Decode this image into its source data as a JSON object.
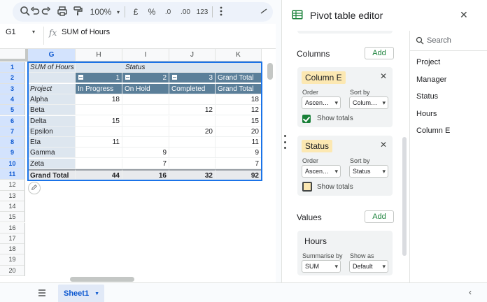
{
  "toolbar": {
    "zoom": "100%",
    "currency": "£",
    "percent": "%",
    "dec_decrease": ".0",
    "dec_increase": ".00",
    "number_format": "123"
  },
  "formula_bar": {
    "cell_ref": "G1",
    "fx": "fx",
    "formula": "SUM of Hours"
  },
  "grid": {
    "columns": [
      "G",
      "H",
      "I",
      "J",
      "K"
    ],
    "rows": [
      "1",
      "2",
      "3",
      "4",
      "5",
      "6",
      "7",
      "8",
      "9",
      "10",
      "11",
      "12",
      "13",
      "14",
      "15",
      "16",
      "17",
      "18",
      "19",
      "20"
    ],
    "pivot": {
      "value_header": "SUM of Hours",
      "col_field": "Status",
      "col_index": [
        "1",
        "2",
        "3"
      ],
      "grand_total": "Grand Total",
      "row_field": "Project",
      "col_labels": [
        "In Progress",
        "On Hold",
        "Completed",
        "Grand Total"
      ],
      "data_rows": [
        {
          "label": "Alpha",
          "vals": [
            "18",
            "",
            "",
            "18"
          ]
        },
        {
          "label": "Beta",
          "vals": [
            "",
            "",
            "12",
            "12"
          ]
        },
        {
          "label": "Delta",
          "vals": [
            "15",
            "",
            "",
            "15"
          ]
        },
        {
          "label": "Epsilon",
          "vals": [
            "",
            "",
            "20",
            "20"
          ]
        },
        {
          "label": "Eta",
          "vals": [
            "11",
            "",
            "",
            "11"
          ]
        },
        {
          "label": "Gamma",
          "vals": [
            "",
            "9",
            "",
            "9"
          ]
        },
        {
          "label": "Zeta",
          "vals": [
            "",
            "7",
            "",
            "7"
          ]
        }
      ],
      "total_row": {
        "label": "Grand Total",
        "vals": [
          "44",
          "16",
          "32",
          "92"
        ]
      }
    }
  },
  "sheet_tabs": {
    "active": "Sheet1"
  },
  "editor": {
    "title": "Pivot table editor",
    "columns_label": "Columns",
    "values_label": "Values",
    "add_label": "Add",
    "cards": [
      {
        "field": "Column E",
        "order_label": "Order",
        "order_value": "Ascen…",
        "sort_label": "Sort by",
        "sort_value": "Colum…",
        "totals_label": "Show totals",
        "totals_checked": true
      },
      {
        "field": "Status",
        "order_label": "Order",
        "order_value": "Ascen…",
        "sort_label": "Sort by",
        "sort_value": "Status",
        "totals_label": "Show totals",
        "totals_checked": false
      }
    ],
    "value_card": {
      "field": "Hours",
      "summarise_label": "Summarise by",
      "summarise_value": "SUM",
      "show_as_label": "Show as",
      "show_as_value": "Default"
    },
    "search_placeholder": "Search",
    "fields": [
      "Project",
      "Manager",
      "Status",
      "Hours",
      "Column E"
    ]
  },
  "colors": {
    "pivot_header": "#5b7f99",
    "pivot_light": "#dde6ef",
    "accent_green": "#188038",
    "chip_yellow": "#fce8b2",
    "selection": "#1a73e8"
  }
}
